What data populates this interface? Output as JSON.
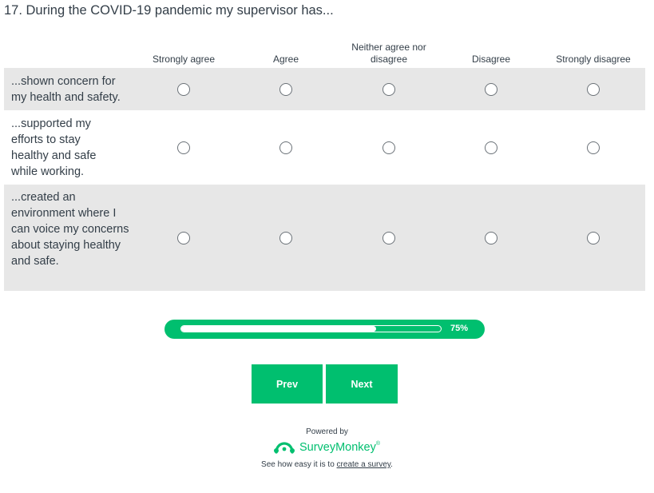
{
  "question": {
    "title": "17. During the COVID-19 pandemic my supervisor has..."
  },
  "columns": [
    "Strongly agree",
    "Agree",
    "Neither agree nor disagree",
    "Disagree",
    "Strongly disagree"
  ],
  "rows": [
    "...shown concern for my health and safety.",
    "...supported my efforts to stay healthy and safe while working.",
    "...created an environment where I can voice my concerns about staying healthy and safe."
  ],
  "progress": {
    "value": 0.75,
    "label": "75%"
  },
  "nav": {
    "prev_label": "Prev",
    "next_label": "Next"
  },
  "footer": {
    "powered_by": "Powered by",
    "brand": "SurveyMonkey",
    "trademark": "®",
    "tagline_prefix": "See how easy it is to ",
    "tagline_link": "create a survey",
    "tagline_suffix": "."
  },
  "colors": {
    "accent": "#00bf6f",
    "row_shade": "#e7e7e7",
    "text": "#333e48"
  }
}
